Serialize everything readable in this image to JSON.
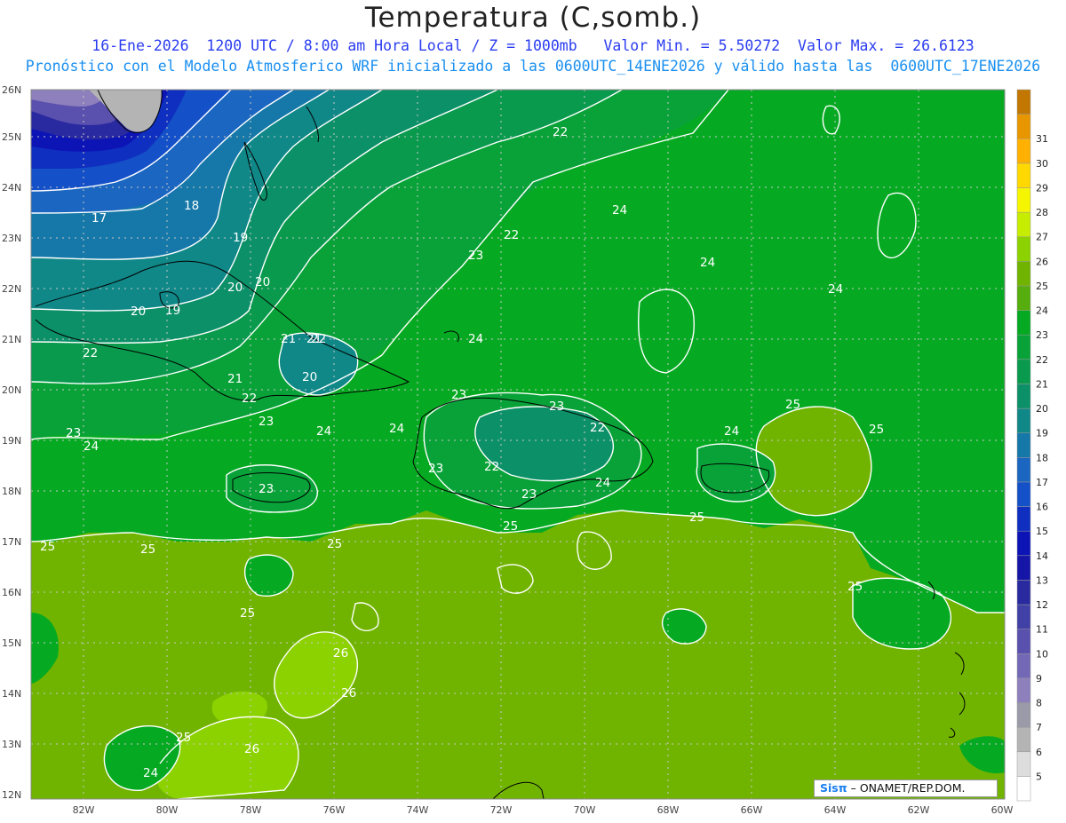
{
  "title": "Temperatura (C,somb.)",
  "subtitle_line1": "16-Ene-2026  1200 UTC / 8:00 am Hora Local / Z = 1000mb   Valor Min. = 5.50272  Valor Max. = 26.6123",
  "subtitle_line2": "Pronóstico con el Modelo Atmosferico WRF inicializado a las 0600UTC_14ENE2026 y válido hasta las  0600UTC_17ENE2026",
  "axes": {
    "lon_labels": [
      "82W",
      "80W",
      "78W",
      "76W",
      "74W",
      "72W",
      "70W",
      "68W",
      "66W",
      "64W",
      "62W",
      "60W"
    ],
    "lat_labels": [
      "12N",
      "13N",
      "14N",
      "15N",
      "16N",
      "17N",
      "18N",
      "19N",
      "20N",
      "21N",
      "22N",
      "23N",
      "24N",
      "25N",
      "26N"
    ],
    "lon_range": [
      -83.2,
      -60
    ],
    "lat_range": [
      12,
      26
    ]
  },
  "colorbar": {
    "labels": [
      "5",
      "6",
      "7",
      "8",
      "9",
      "10",
      "11",
      "12",
      "13",
      "14",
      "15",
      "16",
      "17",
      "18",
      "19",
      "20",
      "21",
      "22",
      "23",
      "24",
      "25",
      "26",
      "27",
      "28",
      "29",
      "30",
      "31"
    ],
    "colors": [
      "#ffffff",
      "#dddddd",
      "#b4b4b4",
      "#9a9aa8",
      "#8e80bc",
      "#7268b6",
      "#5a50ae",
      "#4040a6",
      "#2a2aa0",
      "#1515a8",
      "#0c14b6",
      "#0f2fc0",
      "#1450c8",
      "#1a66c0",
      "#1578a8",
      "#108888",
      "#0c9068",
      "#099a4e",
      "#08a238",
      "#06aa22",
      "#56ad0e",
      "#70b400",
      "#8cd200",
      "#c6ec00",
      "#f5f500",
      "#ffd800",
      "#ffb000",
      "#e89600",
      "#c27800"
    ]
  },
  "contour_labels": {
    "items": [
      "17",
      "18",
      "19",
      "20",
      "20",
      "20",
      "19",
      "21",
      "22",
      "22",
      "21",
      "20",
      "22",
      "23",
      "24",
      "23",
      "22",
      "22",
      "23",
      "24",
      "24",
      "24",
      "24",
      "23",
      "22",
      "23",
      "22",
      "24",
      "25",
      "25",
      "24",
      "25",
      "25",
      "25",
      "25",
      "25",
      "25",
      "26",
      "26",
      "25",
      "26",
      "24",
      "24",
      "23",
      "23",
      "23",
      "24",
      "25",
      "21"
    ]
  },
  "colors": {
    "title": "#222222",
    "subtitle_line1": "#2a3cf0",
    "subtitle_line2": "#1a8ff0",
    "contour": "#ffffff",
    "coastline": "#000000",
    "grid": "#c8c8c8"
  },
  "logo": {
    "brand": "Sisπ",
    "org": "– ONAMET/REP.DOM."
  }
}
